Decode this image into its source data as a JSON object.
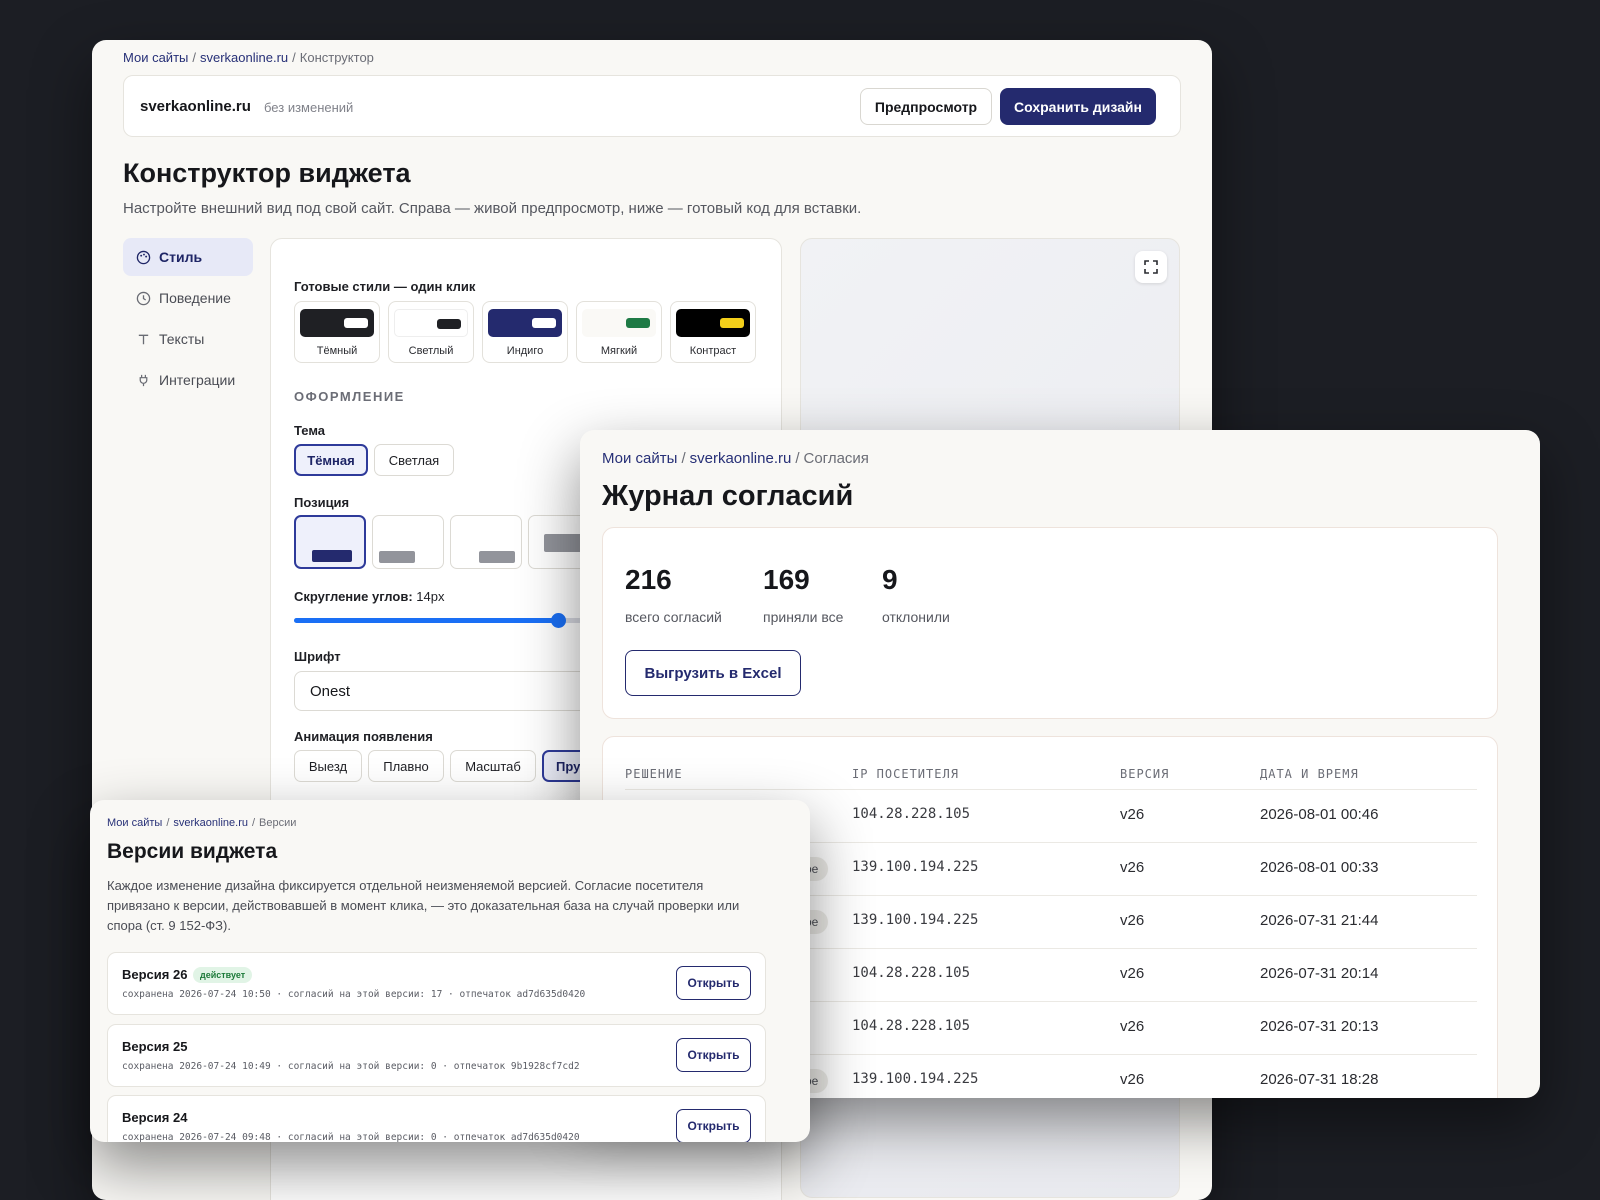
{
  "builder": {
    "breadcrumb": {
      "root": "Мои сайты",
      "site": "sverkaonline.ru",
      "current": "Конструктор"
    },
    "site_name": "sverkaonline.ru",
    "site_status": "без изменений",
    "preview_label": "Предпросмотр",
    "save_label": "Сохранить дизайн",
    "title": "Конструктор виджета",
    "subtitle": "Настройте внешний вид под свой сайт. Справа — живой предпросмотр, ниже — готовый код для вставки.",
    "nav": [
      {
        "label": "Стиль",
        "icon": "palette-icon",
        "active": true
      },
      {
        "label": "Поведение",
        "icon": "clock-icon",
        "active": false
      },
      {
        "label": "Тексты",
        "icon": "text-icon",
        "active": false
      },
      {
        "label": "Интеграции",
        "icon": "plug-icon",
        "active": false
      }
    ],
    "presets_label": "Готовые стили — один клик",
    "presets": [
      {
        "name": "Тёмный",
        "bg": "#1f2024",
        "pill": "#ffffff"
      },
      {
        "name": "Светлый",
        "bg": "#ffffff",
        "pill": "#1f2024"
      },
      {
        "name": "Индиго",
        "bg": "#242a6e",
        "pill": "#ffffff"
      },
      {
        "name": "Мягкий",
        "bg": "#faf9f6",
        "pill": "#1e7a45"
      },
      {
        "name": "Контраст",
        "bg": "#000000",
        "pill": "#f3cf1a"
      }
    ],
    "section_design": "ОФОРМЛЕНИЕ",
    "theme_label": "Тема",
    "theme_options": [
      "Тёмная",
      "Светлая"
    ],
    "theme_selected": "Тёмная",
    "position_label": "Позиция",
    "radius_label": "Скругление углов:",
    "radius_value": "14px",
    "radius_fraction": 0.55,
    "font_label": "Шрифт",
    "font_value": "Onest",
    "animation_label": "Анимация появления",
    "animation_options": [
      "Выезд",
      "Плавно",
      "Масштаб",
      "Пру"
    ],
    "animation_selected": "Пру"
  },
  "consents": {
    "breadcrumb": {
      "root": "Мои сайты",
      "site": "sverkaonline.ru",
      "current": "Согласия"
    },
    "title": "Журнал согласий",
    "stats": [
      {
        "value": "216",
        "label": "всего согласий"
      },
      {
        "value": "169",
        "label": "приняли все"
      },
      {
        "value": "9",
        "label": "отклонили"
      }
    ],
    "export_label": "Выгрузить в Excel",
    "columns": [
      "РЕШЕНИЕ",
      "IP ПОСЕТИТЕЛЯ",
      "ВЕРСИЯ",
      "ДАТА И ВРЕМЯ"
    ],
    "rows": [
      {
        "decision_fragment": "",
        "ip": "104.28.228.105",
        "version": "v26",
        "datetime": "2026-08-01 00:46"
      },
      {
        "decision_fragment": "ое",
        "ip": "139.100.194.225",
        "version": "v26",
        "datetime": "2026-08-01 00:33"
      },
      {
        "decision_fragment": "ое",
        "ip": "139.100.194.225",
        "version": "v26",
        "datetime": "2026-07-31 21:44"
      },
      {
        "decision_fragment": "",
        "ip": "104.28.228.105",
        "version": "v26",
        "datetime": "2026-07-31 20:14"
      },
      {
        "decision_fragment": "",
        "ip": "104.28.228.105",
        "version": "v26",
        "datetime": "2026-07-31 20:13"
      },
      {
        "decision_fragment": "ое",
        "ip": "139.100.194.225",
        "version": "v26",
        "datetime": "2026-07-31 18:28"
      }
    ]
  },
  "versions": {
    "breadcrumb": {
      "root": "Мои сайты",
      "site": "sverkaonline.ru",
      "current": "Версии"
    },
    "title": "Версии виджета",
    "description": "Каждое изменение дизайна фиксируется отдельной неизменяемой версией. Согласие посетителя привязано к версии, действовавшей в момент клика, — это доказательная база на случай проверки или спора (ст. 9 152-ФЗ).",
    "items": [
      {
        "title": "Версия 26",
        "badge": "действует",
        "meta": "сохранена 2026-07-24 10:50 · согласий на этой версии: 17 · отпечаток ad7d635d0420",
        "open_label": "Открыть"
      },
      {
        "title": "Версия 25",
        "badge": "",
        "meta": "сохранена 2026-07-24 10:49 · согласий на этой версии: 0 · отпечаток 9b1928cf7cd2",
        "open_label": "Открыть"
      },
      {
        "title": "Версия 24",
        "badge": "",
        "meta": "сохранена 2026-07-24 09:48 · согласий на этой версии: 0 · отпечаток ad7d635d0420",
        "open_label": "Открыть"
      }
    ]
  }
}
